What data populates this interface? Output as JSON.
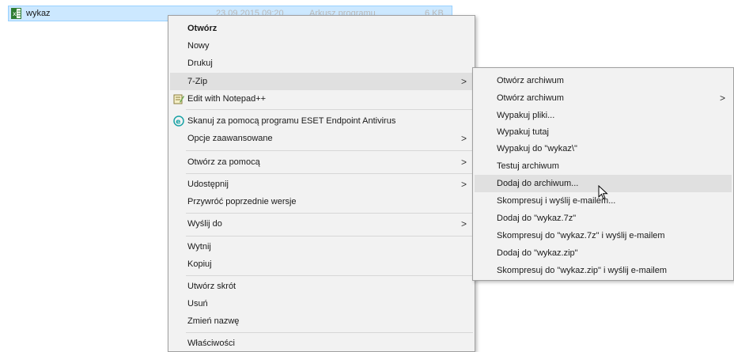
{
  "file": {
    "name": "wykaz",
    "date": "23.09.2015 09:20",
    "type": "Arkusz programu",
    "size": "6 KB"
  },
  "main_menu": {
    "items": [
      {
        "label": "Otwórz"
      },
      {
        "label": "Nowy"
      },
      {
        "label": "Drukuj"
      },
      {
        "label": "7-Zip"
      },
      {
        "label": "Edit with Notepad++"
      },
      {
        "label": "Skanuj za pomocą programu ESET Endpoint Antivirus"
      },
      {
        "label": "Opcje zaawansowane"
      },
      {
        "label": "Otwórz za pomocą"
      },
      {
        "label": "Udostępnij"
      },
      {
        "label": "Przywróć poprzednie wersje"
      },
      {
        "label": "Wyślij do"
      },
      {
        "label": "Wytnij"
      },
      {
        "label": "Kopiuj"
      },
      {
        "label": "Utwórz skrót"
      },
      {
        "label": "Usuń"
      },
      {
        "label": "Zmień nazwę"
      },
      {
        "label": "Właściwości"
      }
    ],
    "arrow": ">"
  },
  "sub_menu": {
    "items": [
      {
        "label": "Otwórz archiwum"
      },
      {
        "label": "Otwórz archiwum"
      },
      {
        "label": "Wypakuj pliki..."
      },
      {
        "label": "Wypakuj tutaj"
      },
      {
        "label": "Wypakuj do \"wykaz\\\""
      },
      {
        "label": "Testuj archiwum"
      },
      {
        "label": "Dodaj do archiwum..."
      },
      {
        "label": "Skompresuj i wyślij e-mailem..."
      },
      {
        "label": "Dodaj do \"wykaz.7z\""
      },
      {
        "label": "Skompresuj do \"wykaz.7z\" i wyślij e-mailem"
      },
      {
        "label": "Dodaj do \"wykaz.zip\""
      },
      {
        "label": "Skompresuj do \"wykaz.zip\" i wyślij e-mailem"
      }
    ],
    "arrow": ">"
  },
  "colors": {
    "selection": "#cce8ff",
    "menu_bg": "#f2f2f2",
    "highlight": "#e0e0e0",
    "eset": "#1aa3a6"
  }
}
